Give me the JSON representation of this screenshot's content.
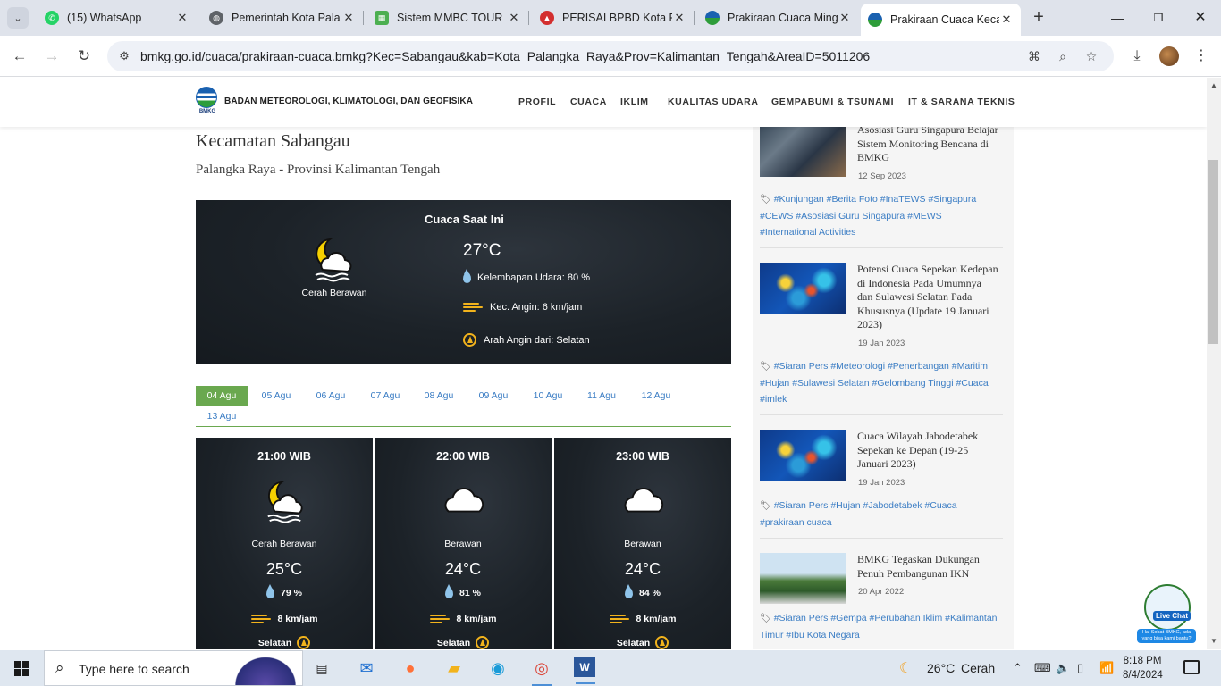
{
  "browser": {
    "tabs": [
      {
        "title": "(15) WhatsApp",
        "favicon": "whatsapp-icon",
        "color": "#25d366"
      },
      {
        "title": "Pemerintah Kota Pala",
        "favicon": "globe-icon",
        "color": "#555555"
      },
      {
        "title": "Sistem MMBC TOUR",
        "favicon": "map-icon",
        "color": "#4caf50"
      },
      {
        "title": "PERISAI BPBD Kota P",
        "favicon": "perisai-icon",
        "color": "#d32f2f"
      },
      {
        "title": "Prakiraan Cuaca Ming",
        "favicon": "bmkg-icon",
        "color": "#1a61b0"
      },
      {
        "title": "Prakiraan Cuaca Keca",
        "favicon": "bmkg-icon",
        "color": "#1a61b0"
      }
    ],
    "url": "bmkg.go.id/cuaca/prakiraan-cuaca.bmkg?Kec=Sabangau&kab=Kota_Palangka_Raya&Prov=Kalimantan_Tengah&AreaID=5011206"
  },
  "header": {
    "brand": "BADAN METEOROLOGI, KLIMATOLOGI, DAN GEOFISIKA",
    "logo_text": "BMKG",
    "nav": [
      "PROFIL",
      "CUACA",
      "IKLIM",
      "KUALITAS UDARA",
      "GEMPABUMI & TSUNAMI",
      "IT & SARANA TEKNIS"
    ]
  },
  "location": {
    "kecamatan": "Kecamatan Sabangau",
    "province": "Palangka Raya - Provinsi Kalimantan Tengah"
  },
  "current": {
    "title": "Cuaca Saat Ini",
    "condition": "Cerah Berawan",
    "temp": "27°C",
    "humidity": "Kelembapan Udara: 80 %",
    "wind": "Kec. Angin: 6 km/jam",
    "wind_dir": "Arah Angin dari: Selatan"
  },
  "days": [
    "04 Agu",
    "05 Agu",
    "06 Agu",
    "07 Agu",
    "08 Agu",
    "09 Agu",
    "10 Agu",
    "11 Agu",
    "12 Agu",
    "13 Agu"
  ],
  "hourly": [
    {
      "time": "21:00 WIB",
      "condition": "Cerah Berawan",
      "temp": "25°C",
      "humidity": "79 %",
      "wind": "8 km/jam",
      "dir": "Selatan",
      "icon": "partly-cloudy-night-icon"
    },
    {
      "time": "22:00 WIB",
      "condition": "Berawan",
      "temp": "24°C",
      "humidity": "81 %",
      "wind": "8 km/jam",
      "dir": "Selatan",
      "icon": "cloud-icon"
    },
    {
      "time": "23:00 WIB",
      "condition": "Berawan",
      "temp": "24°C",
      "humidity": "84 %",
      "wind": "8 km/jam",
      "dir": "Selatan",
      "icon": "cloud-icon"
    }
  ],
  "news": [
    {
      "title": "Asosiasi Guru Singapura Belajar Sistem Monitoring Bencana di BMKG",
      "date": "12 Sep 2023",
      "tags": "#Kunjungan #Berita Foto #InaTEWS #Singapura #CEWS #Asosiasi Guru Singapura #MEWS #International Activities"
    },
    {
      "title": "Potensi Cuaca Sepekan Kedepan di Indonesia Pada Umumnya dan Sulawesi Selatan Pada Khususnya (Update 19 Januari 2023)",
      "date": "19 Jan 2023",
      "tags": "#Siaran Pers #Meteorologi #Penerbangan #Maritim #Hujan #Sulawesi Selatan #Gelombang Tinggi #Cuaca #imlek"
    },
    {
      "title": "Cuaca Wilayah Jabodetabek Sepekan ke Depan (19-25 Januari 2023)",
      "date": "19 Jan 2023",
      "tags": "#Siaran Pers #Hujan #Jabodetabek #Cuaca #prakiraan cuaca"
    },
    {
      "title": "BMKG Tegaskan Dukungan Penuh Pembangunan IKN",
      "date": "20 Apr 2022",
      "tags": "#Siaran Pers #Gempa #Perubahan Iklim #Kalimantan Timur #Ibu Kota Negara"
    }
  ],
  "livechat": {
    "label": "Live Chat",
    "bubble": "Hai Sobat BMKG, ada yang bisa kami bantu?"
  },
  "taskbar": {
    "search_placeholder": "Type here to search",
    "weather_temp": "26°C",
    "weather_text": "Cerah",
    "time": "8:18 PM",
    "date": "8/4/2024"
  }
}
